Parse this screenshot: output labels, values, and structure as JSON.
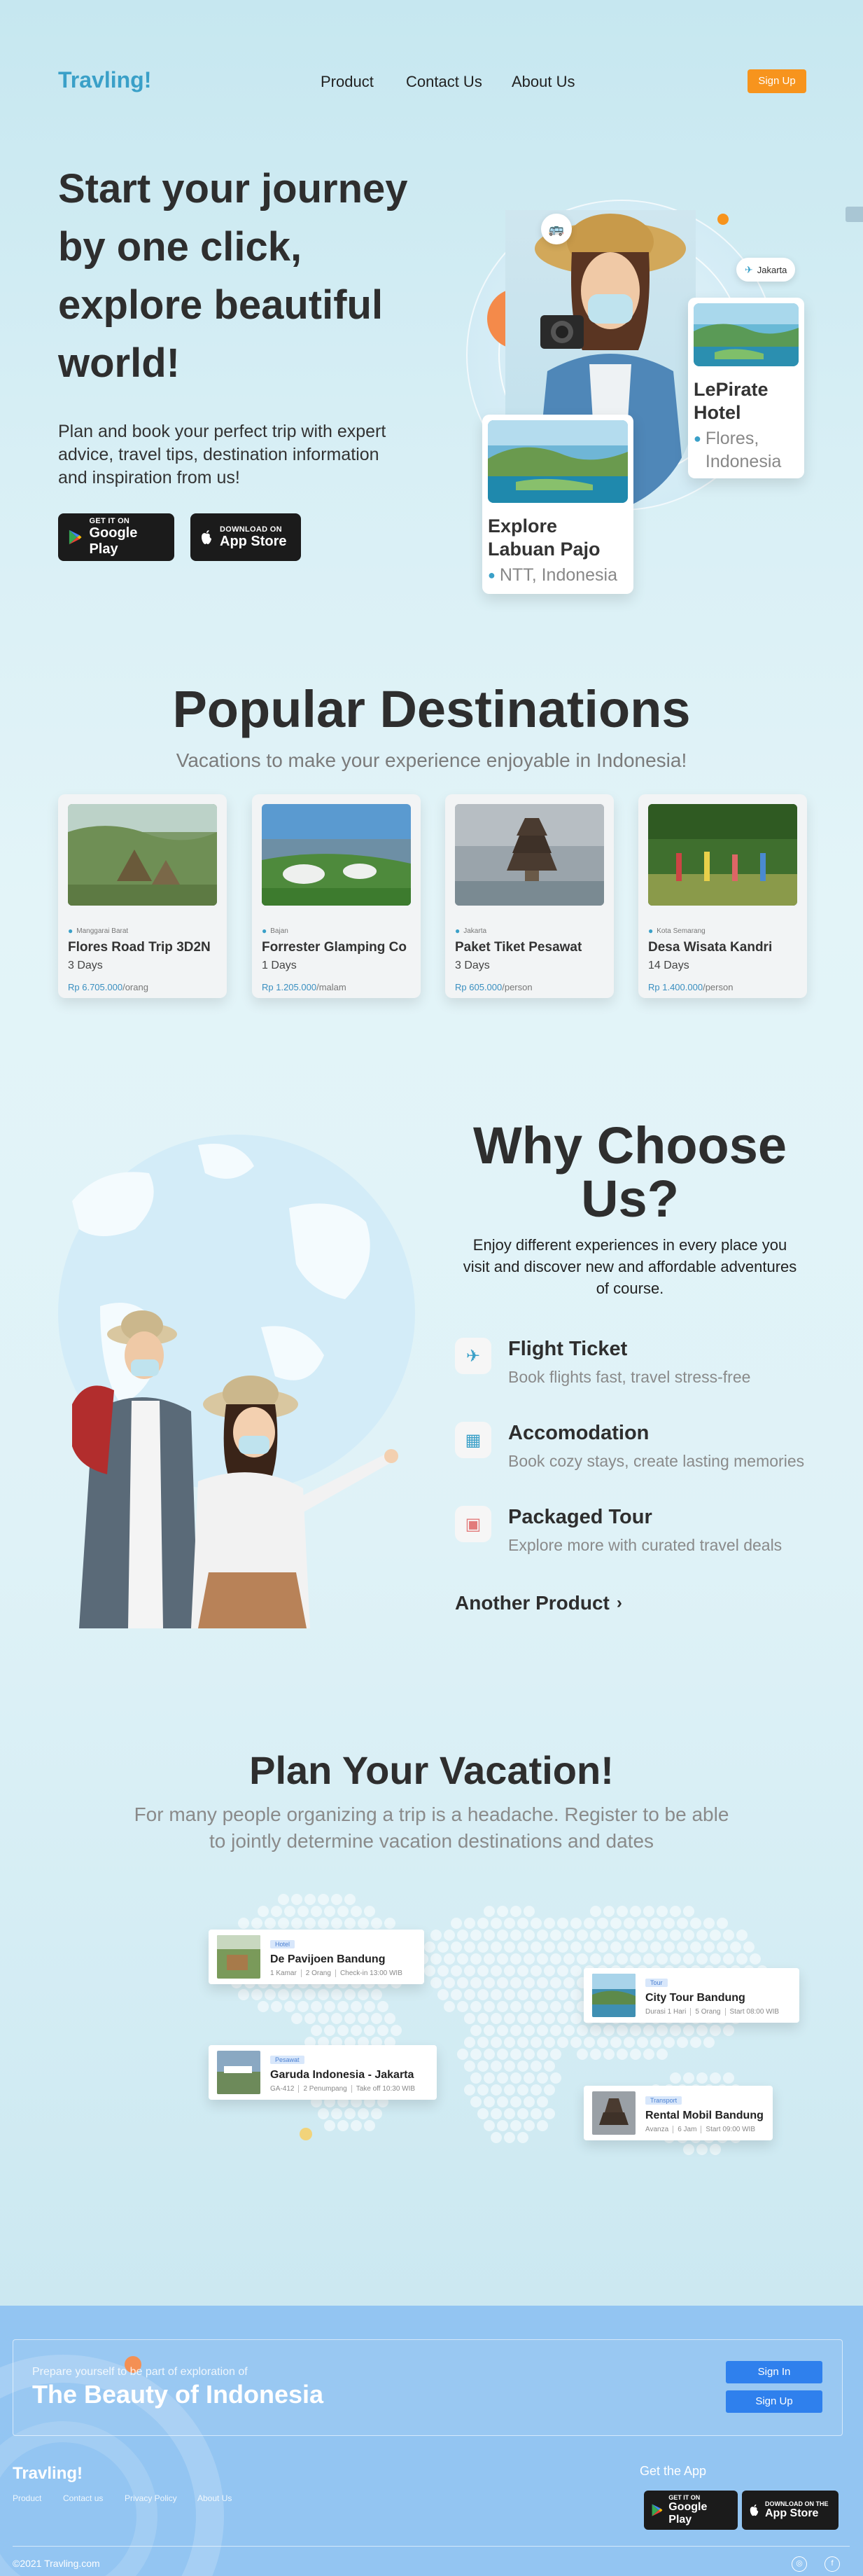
{
  "nav": {
    "logo": "Travling!",
    "links": [
      "Product",
      "Contact Us",
      "About Us"
    ],
    "signup": "Sign Up"
  },
  "hero": {
    "title": "Start your journey by one click, explore beautiful world!",
    "desc": "Plan and book your perfect trip with expert advice, travel tips, destination information and inspiration from us!",
    "google_small": "GET IT ON",
    "google_large": "Google Play",
    "apple_small": "DOWNLOAD ON",
    "apple_large": "App Store",
    "badge_city": "Jakarta",
    "card1_title": "LePirate Hotel",
    "card1_loc": "Flores, Indonesia",
    "card2_title": "Explore Labuan Pajo",
    "card2_loc": "NTT, Indonesia"
  },
  "popular": {
    "title": "Popular Destinations",
    "subtitle": "Vacations to make your experience enjoyable in Indonesia!",
    "items": [
      {
        "loc": "Manggarai Barat",
        "name": "Flores Road Trip 3D2N",
        "days": "3 Days",
        "price": "Rp 6.705.000",
        "unit": "/orang"
      },
      {
        "loc": "Bajan",
        "name": "Forrester Glamping Co",
        "days": "1 Days",
        "price": "Rp 1.205.000",
        "unit": "/malam"
      },
      {
        "loc": "Jakarta",
        "name": "Paket Tiket Pesawat",
        "days": "3 Days",
        "price": "Rp 605.000",
        "unit": "/person"
      },
      {
        "loc": "Kota Semarang",
        "name": "Desa Wisata Kandri",
        "days": "14 Days",
        "price": "Rp 1.400.000",
        "unit": "/person"
      }
    ]
  },
  "why": {
    "title": "Why Choose Us?",
    "desc": "Enjoy different experiences in every place you visit and discover new and affordable adventures of course.",
    "features": [
      {
        "icon": "plane-icon",
        "title": "Flight Ticket",
        "sub": "Book flights fast, travel stress-free"
      },
      {
        "icon": "building-icon",
        "title": "Accomodation",
        "sub": "Book cozy stays, create lasting memories"
      },
      {
        "icon": "luggage-icon",
        "title": "Packaged Tour",
        "sub": "Explore more with curated travel deals"
      }
    ],
    "another": "Another Product"
  },
  "plan": {
    "title": "Plan Your Vacation!",
    "subtitle": "For many people organizing a trip is a headache. Register to be able to jointly determine vacation destinations and dates",
    "cards": [
      {
        "tag": "Hotel",
        "name": "De Pavijoen Bandung",
        "meta": [
          "1 Kamar",
          "2 Orang",
          "Check-in 13:00 WIB"
        ]
      },
      {
        "tag": "Tour",
        "name": "City Tour Bandung",
        "meta": [
          "Durasi 1 Hari",
          "5 Orang",
          "Start 08:00 WIB"
        ]
      },
      {
        "tag": "Pesawat",
        "name": "Garuda Indonesia - Jakarta",
        "meta": [
          "GA-412",
          "2 Penumpang",
          "Take off 10:30 WIB"
        ]
      },
      {
        "tag": "Transport",
        "name": "Rental Mobil Bandung",
        "meta": [
          "Avanza",
          "6 Jam",
          "Start 09:00 WIB"
        ]
      }
    ]
  },
  "footer": {
    "cta_small": "Prepare yourself to be part of exploration of",
    "cta_big": "The Beauty of Indonesia",
    "signin": "Sign In",
    "signup": "Sign Up",
    "logo": "Travling!",
    "links": [
      "Product",
      "Contact us",
      "Privacy Policy",
      "About Us"
    ],
    "get_app": "Get the App",
    "google_small": "GET IT ON",
    "google_large": "Google Play",
    "apple_small": "DOWNLOAD ON THE",
    "apple_large": "App Store",
    "copyright": "©2021 Travling.com"
  },
  "colors": {
    "accent": "#3aa0c8",
    "orange": "#f7941d",
    "price": "#3a8fc0",
    "footer": "#93c5f2",
    "footer_button": "#2f80ed"
  }
}
